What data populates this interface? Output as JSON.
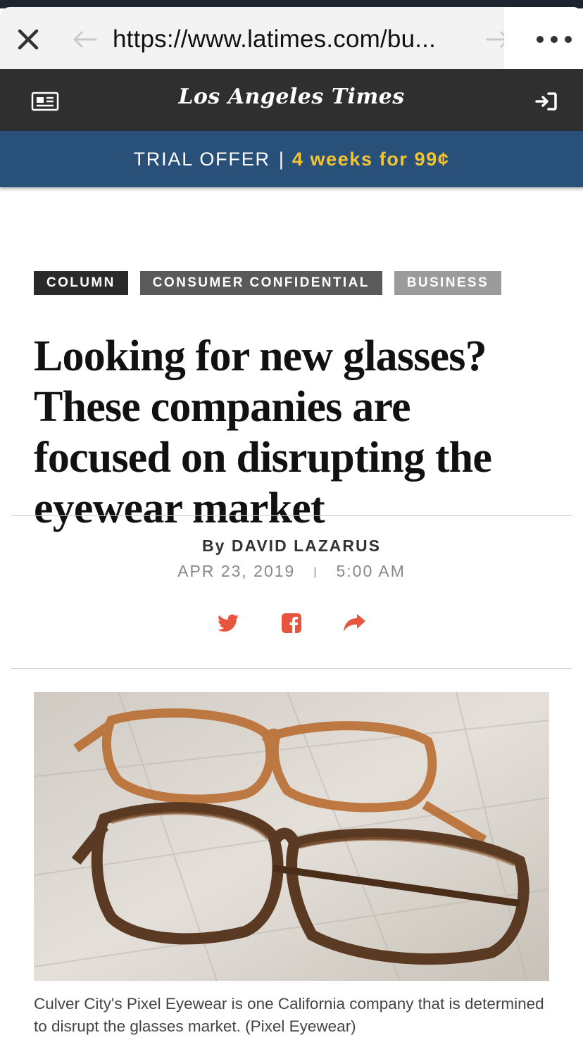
{
  "browser": {
    "url": "https://www.latimes.com/bu...",
    "close_icon": "close-icon",
    "back_icon": "back-arrow-icon",
    "forward_icon": "forward-arrow-icon",
    "more_icon": "more-dots-icon"
  },
  "header": {
    "logo": "Los Angeles Times",
    "menu_icon": "newspaper-icon",
    "signin_icon": "sign-in-icon",
    "background": "#2f2f2f"
  },
  "trial": {
    "label": "TRIAL OFFER",
    "separator": "|",
    "price": "4 weeks for 99¢",
    "background": "#285079",
    "accent": "#f4c330"
  },
  "tags": [
    {
      "label": "COLUMN"
    },
    {
      "label": "CONSUMER CONFIDENTIAL"
    },
    {
      "label": "BUSINESS"
    }
  ],
  "article": {
    "headline": "Looking for new glasses? These companies are focused on disrupting the eyewear market",
    "by": "By",
    "author": "DAVID LAZARUS",
    "date": "APR 23, 2019",
    "date_separator": "|",
    "time": "5:00 AM",
    "share_color": "#e8553e",
    "caption": "Culver City's Pixel Eyewear is one California company that is determined to disrupt the glasses market. (Pixel Eyewear)"
  }
}
